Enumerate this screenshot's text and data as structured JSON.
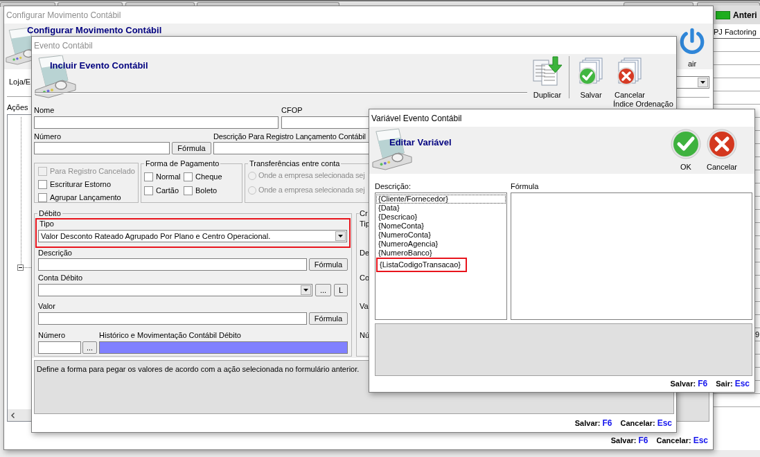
{
  "background_window": {
    "header": "Anteri",
    "column": "PJ Factoring",
    "cell": "9"
  },
  "main_window": {
    "title": "Configurar Movimento Contábil",
    "active": false,
    "heading": "Configurar Movimento Contábil",
    "exit_button": "air",
    "store_label": "Loja/E",
    "actions_label": "Ações",
    "shortcuts": [
      {
        "action": "Salvar:",
        "key": "F6"
      },
      {
        "action": "Cancelar:",
        "key": "Esc"
      }
    ]
  },
  "event_window": {
    "title": "Evento Contábil",
    "active": false,
    "heading": "Incluir Evento Contábil",
    "toolbar": [
      {
        "kind": "duplicate",
        "label": "Duplicar"
      },
      {
        "kind": "save",
        "label": "Salvar"
      },
      {
        "kind": "cancel",
        "label": "Cancelar"
      }
    ],
    "name_label": "Nome",
    "cfop_label": "CFOP",
    "order_label": "Índice Ordenação",
    "number_label": "Número",
    "formula_button": "Fórmula",
    "description_label": "Descrição Para Registro Lançamento Contábil",
    "options": [
      {
        "label": "Para Registro Cancelado",
        "checked": false,
        "disabled": true
      },
      {
        "label": "Escriturar Estorno",
        "checked": false,
        "disabled": false
      },
      {
        "label": "Agrupar Lançamento",
        "checked": false,
        "disabled": false
      }
    ],
    "payment": {
      "title": "Forma de Pagamento",
      "options": [
        {
          "label": "Normal",
          "checked": false
        },
        {
          "label": "Cheque",
          "checked": false
        },
        {
          "label": "Cartão",
          "checked": false
        },
        {
          "label": "Boleto",
          "checked": false
        }
      ]
    },
    "transfers": {
      "title": "Transferências entre conta",
      "options": [
        {
          "label": "Onde a empresa selecionada sej",
          "selected": false,
          "disabled": true
        },
        {
          "label": "Onde a empresa selecionada sej",
          "selected": false,
          "disabled": true
        }
      ]
    },
    "debit": {
      "title": "Débito",
      "type_label": "Tipo",
      "type_value": "Valor Desconto Rateado Agrupado Por Plano e Centro Operacional.",
      "type_highlighted": true,
      "description_label": "Descrição",
      "description_button": "Fórmula",
      "account_label": "Conta Débito",
      "browse_button": "...",
      "l_button": "L",
      "value_label": "Valor",
      "value_button": "Fórmula",
      "number_label": "Número",
      "number_button": "...",
      "history_label": "Histórico e Movimentação Contábil Débito"
    },
    "credit": {
      "title": "Cr",
      "labels": [
        "Tip",
        "De",
        "Co",
        "Va",
        "Nú"
      ]
    },
    "hint": "Define a forma para pegar os valores de acordo com a ação selecionada no formulário anterior.",
    "shortcuts": [
      {
        "action": "Salvar:",
        "key": "F6"
      },
      {
        "action": "Cancelar:",
        "key": "Esc"
      }
    ]
  },
  "variable_window": {
    "title": "Variável Evento Contábil",
    "active": true,
    "heading": "Editar Variável",
    "buttons": [
      {
        "kind": "ok",
        "label": "OK"
      },
      {
        "kind": "cancel",
        "label": "Cancelar"
      }
    ],
    "list_label": "Descrição:",
    "formula_label": "Fórmula",
    "variables": [
      {
        "text": "{Cliente/Fornecedor}",
        "focused": true,
        "highlighted": false
      },
      {
        "text": "{Data}",
        "focused": false,
        "highlighted": false
      },
      {
        "text": "{Descricao}",
        "focused": false,
        "highlighted": false
      },
      {
        "text": "{NomeConta}",
        "focused": false,
        "highlighted": false
      },
      {
        "text": "{NumeroConta}",
        "focused": false,
        "highlighted": false
      },
      {
        "text": "{NumeroAgencia}",
        "focused": false,
        "highlighted": false
      },
      {
        "text": "{NumeroBanco}",
        "focused": false,
        "highlighted": false
      },
      {
        "text": "{ListaCodigoTransacao}",
        "focused": false,
        "highlighted": true
      }
    ],
    "shortcuts": [
      {
        "action": "Salvar:",
        "key": "F6"
      },
      {
        "action": "Sair:",
        "key": "Esc"
      }
    ]
  }
}
